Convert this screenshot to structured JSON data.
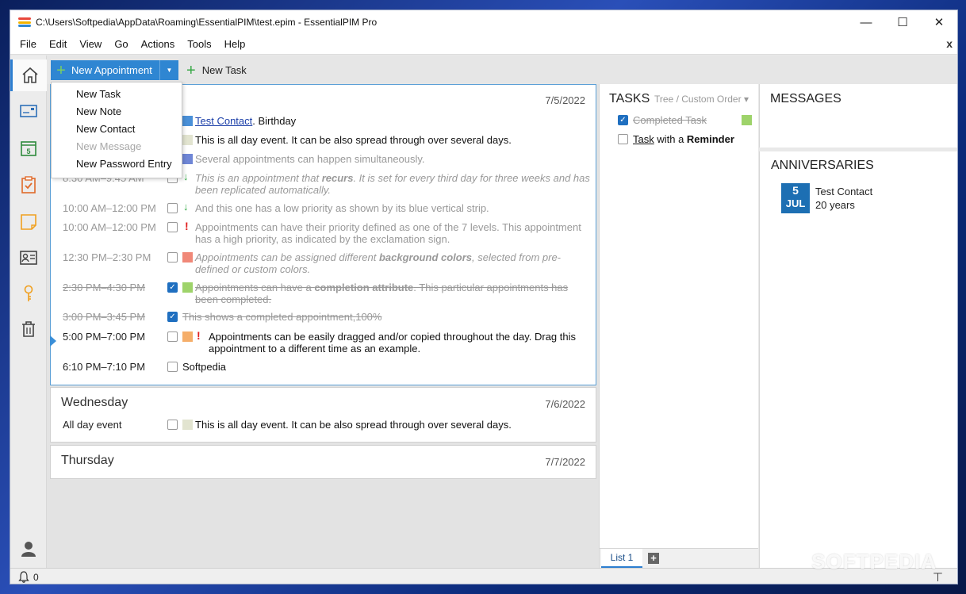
{
  "window": {
    "title": "C:\\Users\\Softpedia\\AppData\\Roaming\\EssentialPIM\\test.epim - EssentialPIM Pro",
    "minimize": "—",
    "maximize": "☐",
    "close": "✕"
  },
  "menu": [
    "File",
    "Edit",
    "View",
    "Go",
    "Actions",
    "Tools",
    "Help"
  ],
  "menu_close": "x",
  "sidebar": [
    "home-icon",
    "mail-icon",
    "calendar-icon",
    "tasks-icon",
    "notes-icon",
    "contacts-icon",
    "passwords-icon",
    "trash-icon",
    "account-icon"
  ],
  "sidebar_calendar_day": "5",
  "toolbar": {
    "new_appointment": "New Appointment",
    "new_task": "New Task",
    "plus": "+"
  },
  "dropdown": {
    "items": [
      {
        "label": "New Task",
        "enabled": true
      },
      {
        "label": "New Note",
        "enabled": true
      },
      {
        "label": "New Contact",
        "enabled": true
      },
      {
        "label": "New Message",
        "enabled": false
      },
      {
        "label": "New Password Entry",
        "enabled": true
      }
    ]
  },
  "days": [
    {
      "name": "",
      "date": "7/5/2022",
      "rows": {
        "r1": {
          "link": "Test Contact",
          "suffix": ". Birthday",
          "color": "#4a90d8"
        },
        "r2": {
          "text": "This is all day event. It can be also spread through over several days.",
          "color": "#e2e4d0"
        },
        "r3": {
          "text": "Several appointments can happen simultaneously.",
          "color": "#6f86d6"
        },
        "r4": {
          "time": "8:30 AM–9:45 AM",
          "text_pre": "This is an appointment that ",
          "text_bold": "recurs",
          "text_post": ". It is set for every third day for three weeks and has been replicated automatically."
        },
        "r5": {
          "time": "10:00 AM–12:00 PM",
          "text": "And this one has a low priority as shown by its blue vertical strip."
        },
        "r6": {
          "time": "10:00 AM–12:00 PM",
          "text": "Appointments can have their priority defined as one of the 7 levels. This appointment has a high priority, as indicated by the exclamation sign."
        },
        "r7": {
          "time": "12:30 PM–2:30 PM",
          "text_pre": "Appointments can be assigned different ",
          "text_bold": "background colors",
          "text_post": ", selected from pre-defined or custom colors.",
          "color": "#f08878"
        },
        "r8": {
          "time": "2:30 PM–4:30 PM",
          "text_pre": "Appointments can have a ",
          "text_bold": "completion attribute",
          "text_post": ". This particular appointments has been completed.",
          "color": "#9ed36a"
        },
        "r9": {
          "time": "3:00 PM–3:45 PM",
          "text": "This shows a completed appointment,100%"
        },
        "r10": {
          "time": "5:00 PM–7:00 PM",
          "text": "Appointments can be easily dragged and/or copied throughout the day. Drag this appointment to a different time as an example.",
          "color": "#f5ae6a"
        },
        "r11": {
          "time": "6:10 PM–7:10 PM",
          "text": "Softpedia"
        }
      }
    },
    {
      "name": "Wednesday",
      "date": "7/6/2022",
      "rows": {
        "r1": {
          "time": "All day event",
          "text": "This is all day event. It can be also spread through over several days.",
          "color": "#e2e4d0"
        }
      }
    },
    {
      "name": "Thursday",
      "date": "7/7/2022"
    }
  ],
  "glyphs": {
    "check": "✓",
    "low_priority": "↓",
    "high_priority": "!"
  },
  "tasks": {
    "header": "TASKS",
    "view": "Tree / Custom Order",
    "view_arrow": "▾",
    "items": [
      {
        "text": "Completed Task",
        "done": true,
        "color": "#9ed36a"
      },
      {
        "text_link": "Task",
        "text_mid": " with a ",
        "text_bold": "Reminder",
        "done": false
      }
    ],
    "list_tab": "List 1",
    "add": "+"
  },
  "messages": {
    "header": "MESSAGES"
  },
  "anniversaries": {
    "header": "ANNIVERSARIES",
    "day": "5",
    "month": "JUL",
    "name": "Test Contact",
    "years": "20 years"
  },
  "status": {
    "count": "0",
    "watermark": "SOFTPEDIA",
    "tool": "⊤"
  },
  "colors": {
    "accent": "#2f86d2",
    "app_icon": [
      "#e8483c",
      "#f4b400",
      "#2f86d2"
    ]
  }
}
